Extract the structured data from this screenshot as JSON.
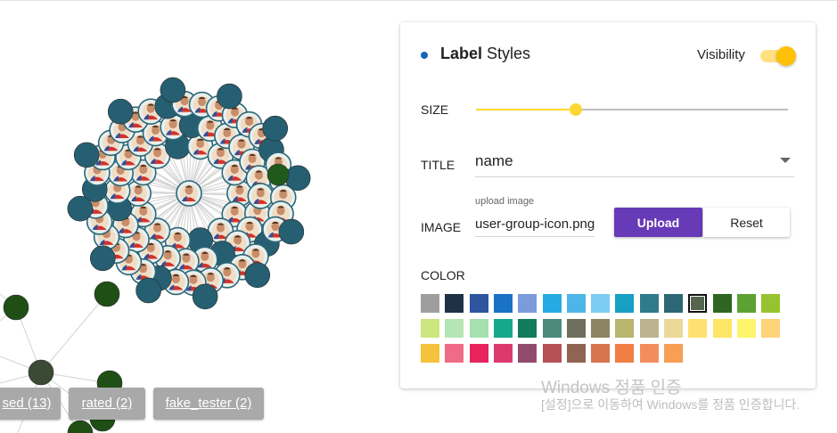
{
  "tags": [
    {
      "label": "sed (13)"
    },
    {
      "label": "rated (2)"
    },
    {
      "label": "fake_tester (2)"
    }
  ],
  "panel": {
    "title_bold": "Label",
    "title_rest": "Styles",
    "visibility_label": "Visibility",
    "visibility_on": true,
    "size_label": "SIZE",
    "size_value": 0.32,
    "title_label": "TITLE",
    "title_value": "name",
    "image_label": "IMAGE",
    "upload_hint": "upload image",
    "image_value": "user-group-icon.png",
    "upload_button": "Upload",
    "reset_button": "Reset",
    "color_label": "COLOR",
    "selected_color_index": 11,
    "colors": [
      "#9e9e9e",
      "#1e3246",
      "#2e55a0",
      "#1a72c4",
      "#7b9bdb",
      "#26aae4",
      "#4cb6e8",
      "#7dcdf2",
      "#17a0c4",
      "#2f7b8b",
      "#2d6776",
      "#55654e",
      "#2e6621",
      "#5ca232",
      "#97c330",
      "#cce680",
      "#b5e4b5",
      "#a7e0b0",
      "#16a88a",
      "#137a5c",
      "#4c8a7e",
      "#6e6e5e",
      "#8c8462",
      "#b9b46e",
      "#bdb28e",
      "#ecd898",
      "#fde070",
      "#fde567",
      "#fdf56b",
      "#fdd478",
      "#f5c33b",
      "#f06b88",
      "#e8235e",
      "#dc3a6e",
      "#914b6c",
      "#b65155",
      "#8f6452",
      "#d7754e",
      "#f07e44",
      "#f48d5e",
      "#f69f55"
    ]
  },
  "watermark": {
    "line1": "Windows 정품 인증",
    "line2": "[설정]으로 이동하여 Windows를 정품 인증합니다."
  }
}
